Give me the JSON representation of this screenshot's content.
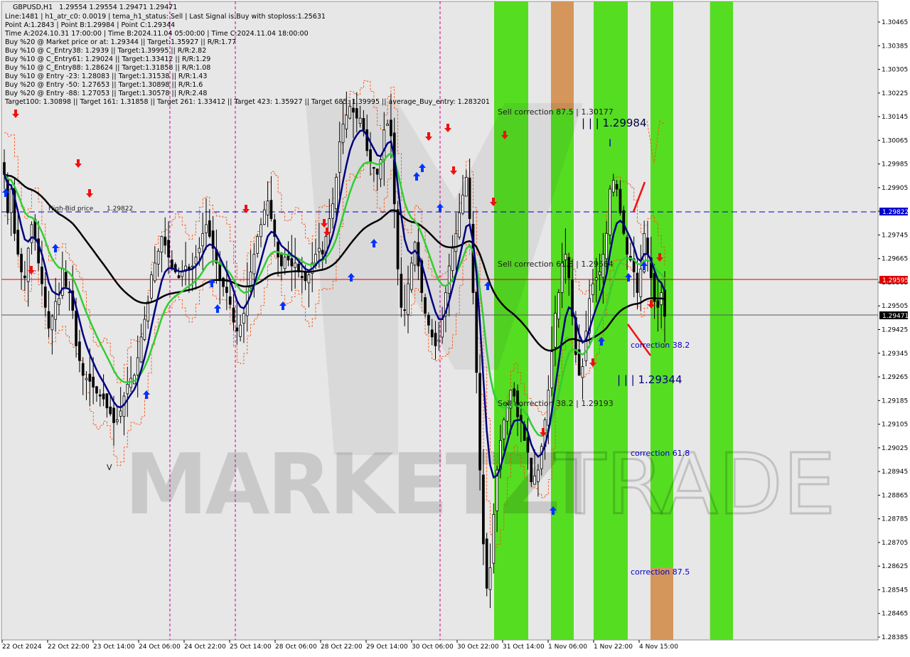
{
  "header": {
    "symbol": "GBPUSD,H1",
    "ohlc": "1.29554 1.29554 1.29471 1.29471"
  },
  "info_lines": [
    "Line:1481 | h1_atr_c0: 0.0019 | tema_h1_status: Sell | Last Signal is:Buy with stoploss:1.25631",
    "Point A:1.2843 | Point B:1.29984 | Point C:1.29344",
    "Time A:2024.10.31 17:00:00 | Time B:2024.11.04 05:00:00 | Time C:2024.11.04 18:00:00",
    "Buy %20 @ Market price or at: 1.29344 || Target:1.35927 || R/R:1.77",
    "Buy %10 @ C_Entry38: 1.2939 || Target:1.39995 || R/R:2.82",
    "Buy %10 @ C_Entry61: 1.29024 || Target:1.33412 || R/R:1.29",
    "Buy %10 @ C_Entry88: 1.28624 || Target:1.31858 || R/R:1.08",
    "Buy %10 @ Entry -23: 1.28083 || Target:1.31538 || R/R:1.43",
    "Buy %20 @ Entry -50: 1.27653 || Target:1.30898 || R/R:1.6",
    "Buy %20 @ Entry -88: 1.27053 || Target:1.30578 || R/R:2.48",
    "Target100: 1.30898 || Target 161: 1.31858 || Target 261: 1.33412 || Target 423: 1.35927 || Target 685: 1.39995 || average_Buy_entry: 1.283201"
  ],
  "watermark": {
    "bold_part": "MARKETZI",
    "thin_part": "TRADE"
  },
  "annotations": {
    "sell_875": "Sell correction 87.5 | 1.30177",
    "sell_618": "Sell correction 61.8 | 1.29664",
    "sell_382": "Sell correction 38.2 | 1.29193",
    "point_b": "| | | 1.29984",
    "point_c": "| | | 1.29344",
    "corr_382": "correction 38.2",
    "corr_618": "correction 61.8",
    "corr_875": "correction 87.5",
    "high_label": "High-Bid price",
    "high_value": "1.29822",
    "point_a_mark": "V",
    "point_b_mark": "I"
  },
  "price_tags": {
    "blue_line": "1.29822",
    "red_line": "1.29595",
    "current": "1.29471"
  },
  "colors": {
    "background": "#ffffff",
    "candles": "#000000",
    "ema_fast": "#000080",
    "ema_mid": "#32cd32",
    "ema_slow": "#000000",
    "envelope": "#ff4500",
    "zone_green": "#55dd22",
    "zone_orange": "#d4965a",
    "hline_blue": "#0000cc",
    "hline_red": "#dd0000",
    "hline_gray": "#4f5a66",
    "vline_magenta": "#cc0099",
    "arrow_up": "#0033ff",
    "arrow_down": "#ee1111"
  },
  "chart_data": {
    "type": "candlestick",
    "symbol": "GBPUSD",
    "timeframe": "H1",
    "ylim": [
      1.28385,
      1.30465
    ],
    "y_ticks": [
      "1.30465",
      "1.30385",
      "1.30305",
      "1.30225",
      "1.30145",
      "1.30065",
      "1.29985",
      "1.29905",
      "1.29825",
      "1.29745",
      "1.29665",
      "1.29585",
      "1.29505",
      "1.29425",
      "1.29345",
      "1.29265",
      "1.29185",
      "1.29105",
      "1.29025",
      "1.28945",
      "1.28865",
      "1.28785",
      "1.28705",
      "1.28625",
      "1.28545",
      "1.28465",
      "1.28385"
    ],
    "x_ticks": [
      "22 Oct 2024",
      "22 Oct 22:00",
      "23 Oct 14:00",
      "24 Oct 06:00",
      "24 Oct 22:00",
      "25 Oct 14:00",
      "28 Oct 06:00",
      "28 Oct 22:00",
      "29 Oct 14:00",
      "30 Oct 06:00",
      "30 Oct 22:00",
      "31 Oct 14:00",
      "1 Nov 06:00",
      "1 Nov 22:00",
      "4 Nov 15:00"
    ],
    "hlines": [
      {
        "name": "high-bid",
        "value": 1.29822
      },
      {
        "name": "level",
        "value": 1.29595
      },
      {
        "name": "last-price",
        "value": 1.29471
      }
    ],
    "close_series": [
      1.2995,
      1.2982,
      1.299,
      1.2975,
      1.2968,
      1.2962,
      1.296,
      1.297,
      1.2978,
      1.2973,
      1.2965,
      1.2958,
      1.295,
      1.2943,
      1.2947,
      1.2952,
      1.2953,
      1.2963,
      1.2957,
      1.2955,
      1.2949,
      1.2937,
      1.2932,
      1.2927,
      1.2926,
      1.2925,
      1.2923,
      1.2921,
      1.292,
      1.2919,
      1.2916,
      1.2914,
      1.2911,
      1.2912,
      1.2915,
      1.292,
      1.2924,
      1.2926,
      1.2927,
      1.2933,
      1.294,
      1.2946,
      1.2952,
      1.2961,
      1.2965,
      1.2969,
      1.2974,
      1.2971,
      1.2967,
      1.2963,
      1.2962,
      1.296,
      1.2962,
      1.2964,
      1.2963,
      1.2964,
      1.2967,
      1.297,
      1.2975,
      1.2978,
      1.2974,
      1.297,
      1.2965,
      1.2959,
      1.2957,
      1.2955,
      1.2951,
      1.2945,
      1.2942,
      1.2944,
      1.2948,
      1.2957,
      1.2962,
      1.2968,
      1.2974,
      1.2978,
      1.2983,
      1.2986,
      1.298,
      1.2974,
      1.2967,
      1.2964,
      1.2967,
      1.2966,
      1.2964,
      1.2965,
      1.2962,
      1.296,
      1.2959,
      1.2961,
      1.2965,
      1.2968,
      1.297,
      1.2968,
      1.2974,
      1.298,
      1.2985,
      1.2994,
      1.3006,
      1.3012,
      1.3015,
      1.3018,
      1.3016,
      1.3014,
      1.3014,
      1.301,
      1.3003,
      1.2999,
      1.2997,
      1.2995,
      1.3,
      1.301,
      1.3012,
      1.3008,
      1.2985,
      1.2963,
      1.295,
      1.2949,
      1.2958,
      1.2965,
      1.2972,
      1.2964,
      1.2955,
      1.2948,
      1.2944,
      1.294,
      1.2937,
      1.2939,
      1.2946,
      1.2955,
      1.2964,
      1.297,
      1.2975,
      1.2982,
      1.2988,
      1.2994,
      1.298,
      1.2955,
      1.2928,
      1.2895,
      1.287,
      1.2855,
      1.2862,
      1.288,
      1.2895,
      1.2905,
      1.2912,
      1.2917,
      1.2922,
      1.292,
      1.2913,
      1.2912,
      1.2905,
      1.2901,
      1.2891,
      1.2893,
      1.2895,
      1.2903,
      1.2912,
      1.2922,
      1.2935,
      1.2948,
      1.2955,
      1.2965,
      1.2968,
      1.296,
      1.2947,
      1.2934,
      1.2927,
      1.293,
      1.2942,
      1.2953,
      1.2958,
      1.296,
      1.2962,
      1.2968,
      1.2975,
      1.299,
      1.2993,
      1.299,
      1.2982,
      1.2975,
      1.2968,
      1.2966,
      1.2962,
      1.2955,
      1.2963,
      1.2975,
      1.2968,
      1.296,
      1.2952,
      1.295,
      1.2955,
      1.2947
    ]
  }
}
